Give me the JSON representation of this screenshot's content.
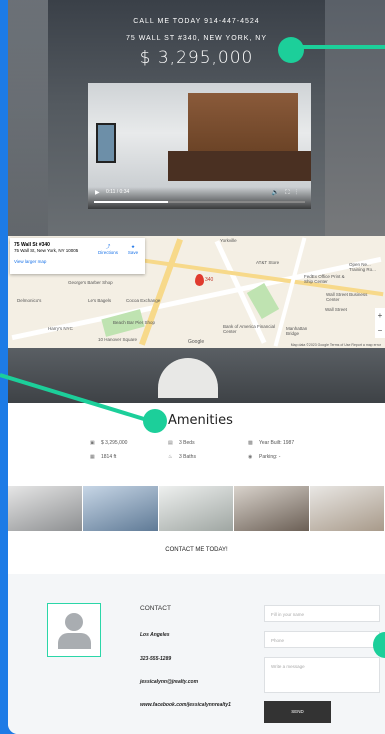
{
  "hero": {
    "call_text": "CALL ME TODAY 914-447-4524",
    "address": "75 WALL ST #340, NEW YORK, NY",
    "price": "$ 3,295,000",
    "video_time": "0:11 / 0:34"
  },
  "map": {
    "card_title": "75 Wall St #340",
    "card_address": "75 Wall St, New York, NY 10005",
    "card_link": "View larger map",
    "directions_label": "Directions",
    "save_label": "Save",
    "pin_label": "340",
    "labels": [
      "Yorkville",
      "AT&T Store",
      "FedEx Office Print & Ship Center",
      "Wall Street Business Center",
      "Bank of America Financial Center",
      "Cocoa Exchange",
      "Le's Bagels",
      "George's Barber Shop",
      "Delmonico's",
      "Harry's NYC",
      "Beach Bar Pier Shop",
      "10 Hanover Square",
      "Wall Street",
      "Manhattan Bridge",
      "Open Ne... Training Ro..."
    ],
    "footer": "Map data ©2023 Google   Terms of Use   Report a map error",
    "google_label": "Google"
  },
  "amenities": {
    "title": "Amenities",
    "items": [
      {
        "icon": "price-icon",
        "text": "$ 3,295,000"
      },
      {
        "icon": "bed-icon",
        "text": "3 Beds"
      },
      {
        "icon": "chart-icon",
        "text": "Year Built: 1987"
      },
      {
        "icon": "area-icon",
        "text": "1814 ft"
      },
      {
        "icon": "bath-icon",
        "text": "3 Baths"
      },
      {
        "icon": "parking-icon",
        "text": "Parking: -"
      }
    ]
  },
  "contact_link": "CONTACT ME TODAY!",
  "footer": {
    "contact_title": "CONTACT",
    "city": "Los Angeles",
    "phone": "323-555-1289",
    "email": "jessicalynn@jrealty.com",
    "facebook": "www.facebook.com/jessicalynnrealty1",
    "name_placeholder": "Fill in your name",
    "phone_placeholder": "Phone",
    "message_placeholder": "Write a message",
    "send_label": "SEND"
  },
  "colors": {
    "accent": "#1ccf9a",
    "background": "#1d7be6",
    "send": "#333333"
  }
}
